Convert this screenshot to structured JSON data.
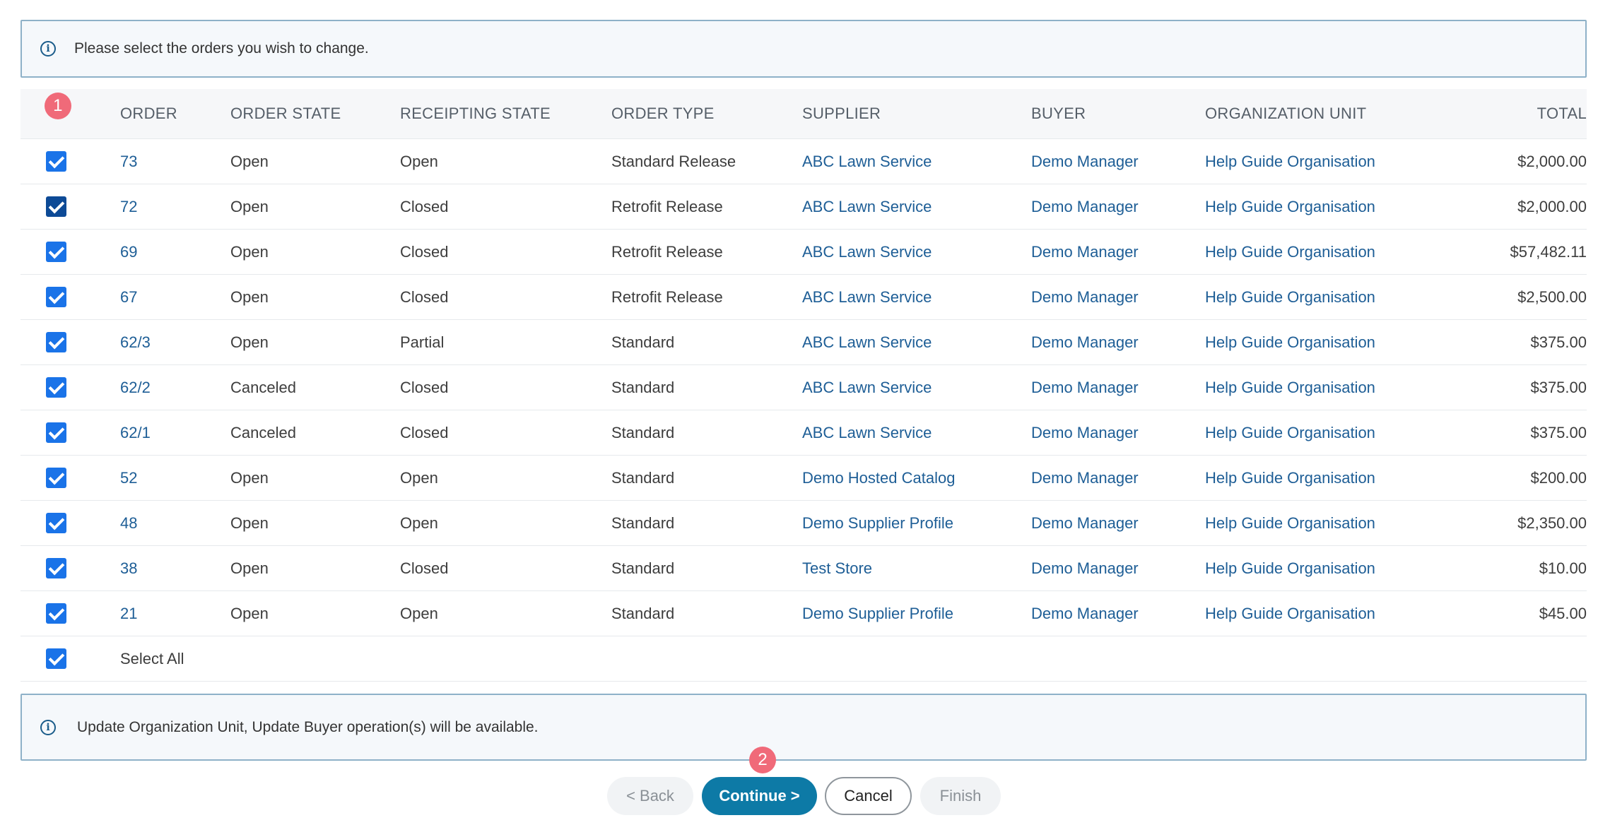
{
  "info_top": {
    "text": "Please select the orders you wish to change."
  },
  "info_bottom": {
    "text": "Update Organization Unit, Update Buyer operation(s) will be available."
  },
  "badges": {
    "step1": "1",
    "step2": "2"
  },
  "table": {
    "headers": [
      "ORDER",
      "ORDER STATE",
      "RECEIPTING STATE",
      "ORDER TYPE",
      "SUPPLIER",
      "BUYER",
      "ORGANIZATION UNIT",
      "TOTAL"
    ],
    "rows": [
      {
        "order": "73",
        "order_state": "Open",
        "receipting_state": "Open",
        "order_type": "Standard Release",
        "supplier": "ABC Lawn Service",
        "buyer": "Demo Manager",
        "org_unit": "Help Guide Organisation",
        "total": "$2,000.00"
      },
      {
        "order": "72",
        "order_state": "Open",
        "receipting_state": "Closed",
        "order_type": "Retrofit Release",
        "supplier": "ABC Lawn Service",
        "buyer": "Demo Manager",
        "org_unit": "Help Guide Organisation",
        "total": "$2,000.00"
      },
      {
        "order": "69",
        "order_state": "Open",
        "receipting_state": "Closed",
        "order_type": "Retrofit Release",
        "supplier": "ABC Lawn Service",
        "buyer": "Demo Manager",
        "org_unit": "Help Guide Organisation",
        "total": "$57,482.11"
      },
      {
        "order": "67",
        "order_state": "Open",
        "receipting_state": "Closed",
        "order_type": "Retrofit Release",
        "supplier": "ABC Lawn Service",
        "buyer": "Demo Manager",
        "org_unit": "Help Guide Organisation",
        "total": "$2,500.00"
      },
      {
        "order": "62/3",
        "order_state": "Open",
        "receipting_state": "Partial",
        "order_type": "Standard",
        "supplier": "ABC Lawn Service",
        "buyer": "Demo Manager",
        "org_unit": "Help Guide Organisation",
        "total": "$375.00"
      },
      {
        "order": "62/2",
        "order_state": "Canceled",
        "receipting_state": "Closed",
        "order_type": "Standard",
        "supplier": "ABC Lawn Service",
        "buyer": "Demo Manager",
        "org_unit": "Help Guide Organisation",
        "total": "$375.00"
      },
      {
        "order": "62/1",
        "order_state": "Canceled",
        "receipting_state": "Closed",
        "order_type": "Standard",
        "supplier": "ABC Lawn Service",
        "buyer": "Demo Manager",
        "org_unit": "Help Guide Organisation",
        "total": "$375.00"
      },
      {
        "order": "52",
        "order_state": "Open",
        "receipting_state": "Open",
        "order_type": "Standard",
        "supplier": "Demo Hosted Catalog",
        "buyer": "Demo Manager",
        "org_unit": "Help Guide Organisation",
        "total": "$200.00"
      },
      {
        "order": "48",
        "order_state": "Open",
        "receipting_state": "Open",
        "order_type": "Standard",
        "supplier": "Demo Supplier Profile",
        "buyer": "Demo Manager",
        "org_unit": "Help Guide Organisation",
        "total": "$2,350.00"
      },
      {
        "order": "38",
        "order_state": "Open",
        "receipting_state": "Closed",
        "order_type": "Standard",
        "supplier": "Test Store",
        "buyer": "Demo Manager",
        "org_unit": "Help Guide Organisation",
        "total": "$10.00"
      },
      {
        "order": "21",
        "order_state": "Open",
        "receipting_state": "Open",
        "order_type": "Standard",
        "supplier": "Demo Supplier Profile",
        "buyer": "Demo Manager",
        "org_unit": "Help Guide Organisation",
        "total": "$45.00"
      }
    ],
    "select_all_label": "Select All"
  },
  "buttons": {
    "back": "< Back",
    "continue": "Continue >",
    "cancel": "Cancel",
    "finish": "Finish"
  },
  "colors": {
    "checkbox": "#1a73e8",
    "link": "#1e5e96",
    "primary_button": "#0d7aa6",
    "badge": "#f06a79"
  }
}
